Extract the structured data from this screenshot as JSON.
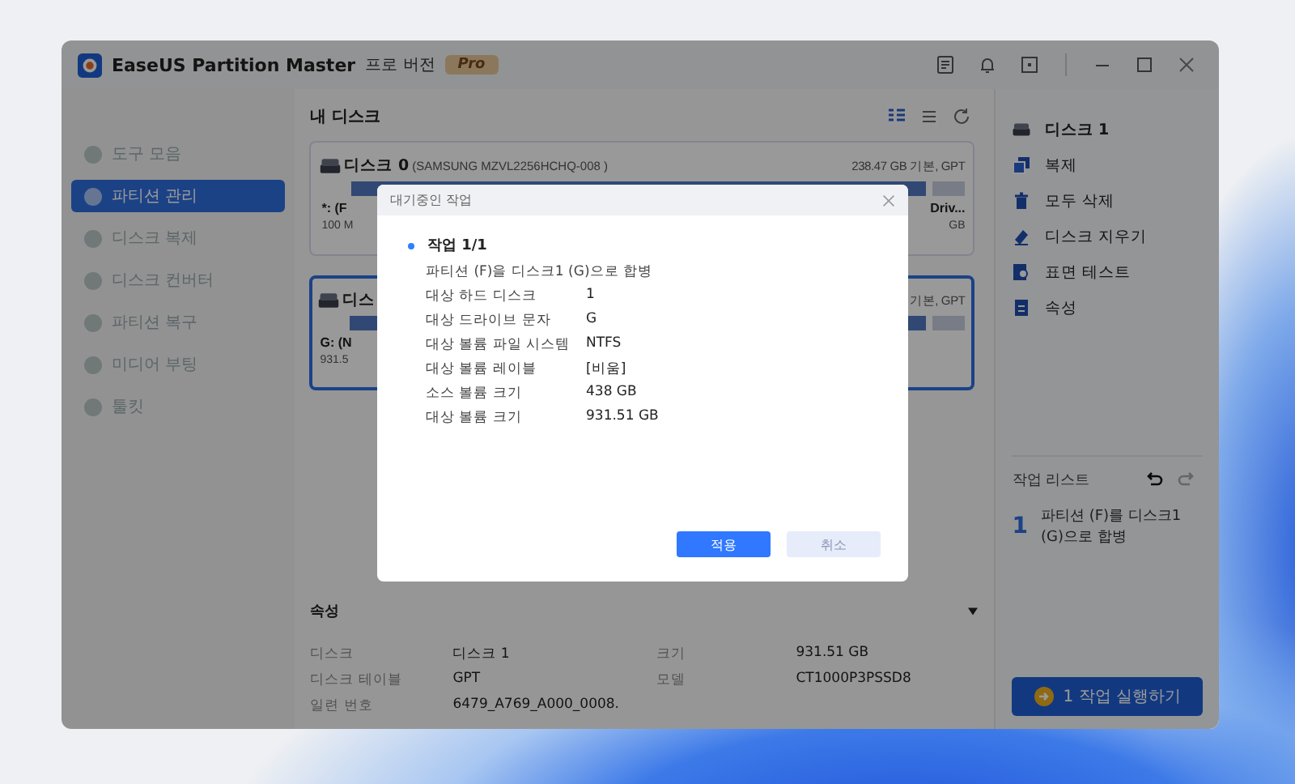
{
  "window": {
    "title": "EaseUS Partition Master",
    "edition": "프로 버전",
    "badge": "Pro"
  },
  "sidebar": {
    "items": [
      {
        "label": "도구 모음",
        "selected": false
      },
      {
        "label": "파티션 관리",
        "selected": true
      },
      {
        "label": "디스크 복제",
        "selected": false
      },
      {
        "label": "디스크 컨버터",
        "selected": false
      },
      {
        "label": "파티션 복구",
        "selected": false
      },
      {
        "label": "미디어 부팅",
        "selected": false
      },
      {
        "label": "툴킷",
        "selected": false
      }
    ]
  },
  "disks": {
    "title": "내 디스크",
    "cards": [
      {
        "name": "디스크 0",
        "model": "(SAMSUNG MZVL2256HCHQ-008 )",
        "info": "238.47 GB 기본, GPT",
        "selected": false,
        "left_label": "*: (F",
        "left_size": "100 M",
        "right_label": "Driv...",
        "right_size": "GB"
      },
      {
        "name": "디스",
        "info": "기본, GPT",
        "selected": true,
        "left_label": "G: (N",
        "left_size": "931.5"
      }
    ]
  },
  "properties": {
    "title": "속성",
    "rows": [
      {
        "label": "디스크",
        "value": "디스크 1",
        "label_2": "크기",
        "value_2": "931.51 GB"
      },
      {
        "label": "디스크 테이블",
        "value": "GPT",
        "label_2": "모델",
        "value_2": "CT1000P3PSSD8"
      },
      {
        "label": "일련 번호",
        "value": "6479_A769_A000_0008."
      }
    ]
  },
  "actions": {
    "disk_label": "디스크 1",
    "items": [
      {
        "label": "복제",
        "kind": "clone"
      },
      {
        "label": "모두 삭제",
        "kind": "trash"
      },
      {
        "label": "디스크 지우기",
        "kind": "eraser"
      },
      {
        "label": "표면 테스트",
        "kind": "scan"
      },
      {
        "label": "속성",
        "kind": "doc"
      }
    ]
  },
  "task_list": {
    "title": "작업 리스트",
    "items": [
      {
        "number": "1",
        "text": "파티션 (F)를 디스크1 (G)으로 합병"
      }
    ],
    "run_button": "1 작업 실행하기"
  },
  "dialog": {
    "title": "대기중인 작업",
    "task_title": "작업 1/1",
    "description": "파티션 (F)을 디스크1 (G)으로 합병",
    "details": [
      {
        "label": "대상 하드 디스크",
        "value": "1"
      },
      {
        "label": "대상 드라이브 문자",
        "value": "G"
      },
      {
        "label": "대상 볼륨 파일 시스템",
        "value": "NTFS"
      },
      {
        "label": "대상 볼륨 레이블",
        "value": "[비움]"
      },
      {
        "label": "소스 볼륨 크기",
        "value": "438 GB"
      },
      {
        "label": "대상 볼륨 크기",
        "value": "931.51 GB"
      }
    ],
    "buttons": [
      {
        "label": "적용",
        "kind": "primary"
      },
      {
        "label": "취소",
        "kind": "secondary"
      }
    ]
  }
}
